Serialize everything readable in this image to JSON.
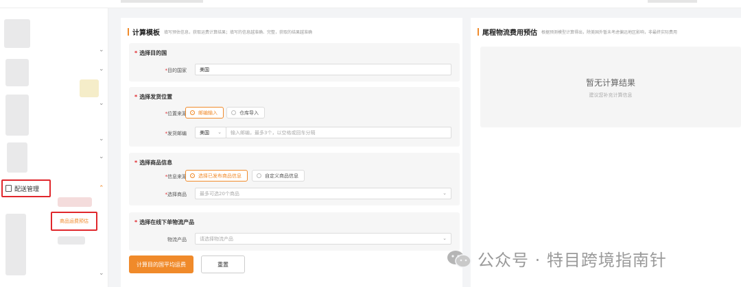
{
  "sidebar": {
    "config_menu": "配送管理",
    "sub_menu": "商品运费预估"
  },
  "form": {
    "title": "计算模板",
    "hint": "填写预估信息，获取运费计算结果；填写的信息越准确、完整，获取的结果越准确",
    "section_destination": {
      "title": "选择目的国",
      "label": "目的国家",
      "value": "美国"
    },
    "section_origin": {
      "title": "选择发货位置",
      "label_source": "位置来源",
      "option_postal": "邮编输入",
      "option_warehouse": "仓库导入",
      "label_postal": "发货邮编",
      "country_value": "美国",
      "postal_placeholder": "输入邮编，最多3个，以空格或回车分隔"
    },
    "section_goods": {
      "title": "选择商品信息",
      "label_source": "信息来源",
      "option_published": "选择已发布商品信息",
      "option_custom": "自定义商品信息",
      "label_goods": "选择商品",
      "goods_placeholder": "最多可选20个商品"
    },
    "section_logistics": {
      "title": "选择在线下单物流产品",
      "label": "物流产品",
      "placeholder": "请选择物流产品"
    },
    "btn_calculate": "计算目的国平均运费",
    "btn_reset": "重置"
  },
  "result": {
    "title": "尾程物流费用预估",
    "hint": "根据预测模型计算得出，除美国外暂未考虑偏远地区影响，非最终实际费用",
    "empty_title": "暂无计算结果",
    "empty_sub": "建议您补充计算信息"
  },
  "watermark": {
    "text": "公众号 · 特目跨境指南针"
  },
  "colors": {
    "accent": "#f08a2a",
    "highlight_box": "#e0262b"
  }
}
